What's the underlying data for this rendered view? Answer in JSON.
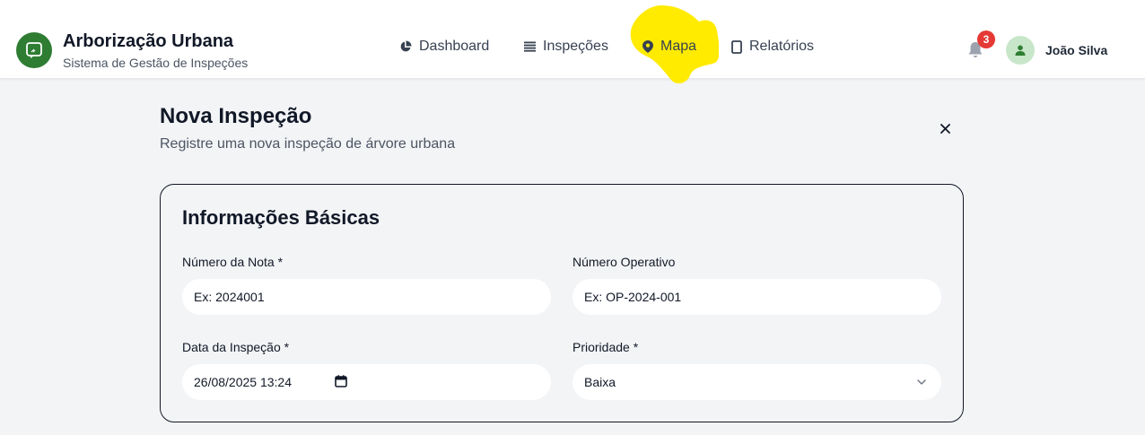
{
  "brand": {
    "title": "Arborização Urbana",
    "subtitle": "Sistema de Gestão de Inspeções",
    "logo_icon": "tablet-leaf-icon",
    "color": "#2e7d32"
  },
  "nav": {
    "items": [
      {
        "label": "Dashboard",
        "icon": "pie-chart-icon"
      },
      {
        "label": "Inspeções",
        "icon": "list-icon"
      },
      {
        "label": "Mapa",
        "icon": "map-pin-icon",
        "highlighted": true
      },
      {
        "label": "Relatórios",
        "icon": "document-icon"
      }
    ],
    "highlight_color": "#ffeb00"
  },
  "header_right": {
    "notification_count": "3",
    "badge_color": "#e53935",
    "user_name": "João Silva",
    "avatar_icon": "user-icon"
  },
  "page": {
    "title": "Nova Inspeção",
    "subtitle": "Registre uma nova inspeção de árvore urbana",
    "close_icon": "close-icon"
  },
  "basic_info": {
    "title": "Informações Básicas",
    "fields": {
      "numero_nota": {
        "label": "Número da Nota *",
        "placeholder": "Ex: 2024001"
      },
      "numero_operativo": {
        "label": "Número Operativo",
        "placeholder": "Ex: OP-2024-001"
      },
      "data_inspecao": {
        "label": "Data da Inspeção *",
        "value": "26/08/2025 13:24"
      },
      "prioridade": {
        "label": "Prioridade *",
        "value": "Baixa"
      }
    }
  }
}
